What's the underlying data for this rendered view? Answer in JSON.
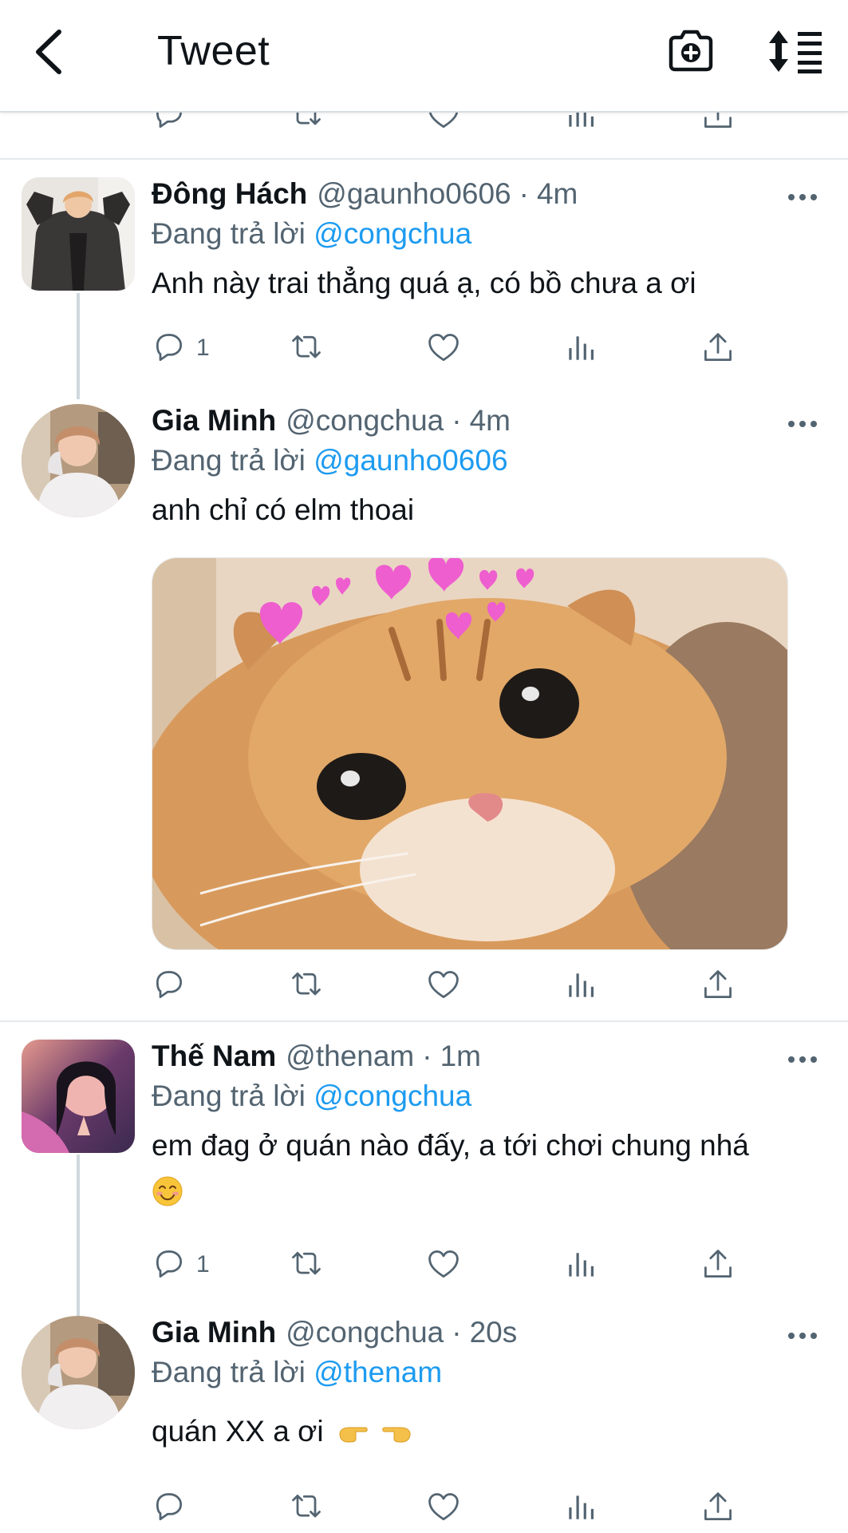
{
  "header": {
    "title": "Tweet",
    "back_icon": "chevron-left-icon",
    "camera_icon": "camera-plus-icon",
    "sort_icon": "sort-list-icon"
  },
  "colors": {
    "link": "#1d9bf0",
    "secondary_text": "#536471",
    "primary_text": "#0f1419",
    "divider": "#e6e9ec"
  },
  "action_icons": [
    "reply-icon",
    "retweet-icon",
    "like-icon",
    "views-icon",
    "share-icon"
  ],
  "tweets": [
    {
      "name": "Đông Hách",
      "handle": "@gaunho0606",
      "time": "4m",
      "replying_prefix": "Đang trả lời",
      "replying_to": "@congchua",
      "text": "Anh này trai thẳng quá ạ, có bồ chưa a ơi",
      "reply_count": "1"
    },
    {
      "name": "Gia Minh",
      "handle": "@congchua",
      "time": "4m",
      "replying_prefix": "Đang trả lời",
      "replying_to": "@gaunho0606",
      "text": "anh chỉ có elm thoai",
      "media": "cat-with-hearts-photo"
    },
    {
      "name": "Thế Nam",
      "handle": "@thenam",
      "time": "1m",
      "replying_prefix": "Đang trả lời",
      "replying_to": "@congchua",
      "text_line1": "em đag ở quán nào đấy, a tới chơi chung nhá",
      "text_emoji": "blushing-smile-emoji",
      "reply_count": "1"
    },
    {
      "name": "Gia Minh",
      "handle": "@congchua",
      "time": "20s",
      "replying_prefix": "Đang trả lời",
      "replying_to": "@thenam",
      "text": "quán XX a ơi",
      "text_emojis": [
        "pointing-right-emoji",
        "pointing-left-emoji"
      ]
    }
  ],
  "separator_dot": "·"
}
